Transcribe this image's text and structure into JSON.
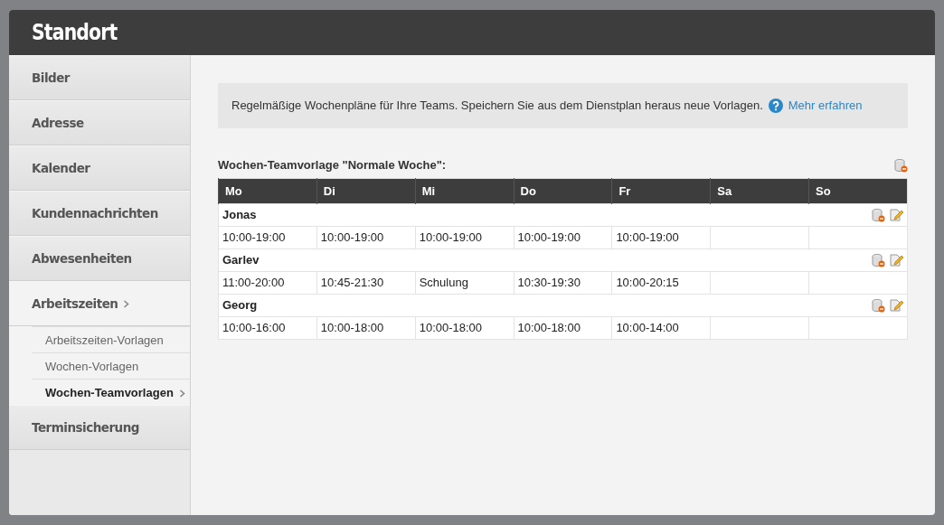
{
  "header": {
    "title": "Standort"
  },
  "sidebar": {
    "items": [
      {
        "label": "Bilder",
        "expanded": false
      },
      {
        "label": "Adresse",
        "expanded": false
      },
      {
        "label": "Kalender",
        "expanded": false
      },
      {
        "label": "Kundennachrichten",
        "expanded": false
      },
      {
        "label": "Abwesenheiten",
        "expanded": false
      },
      {
        "label": "Arbeitszeiten",
        "expanded": true,
        "children": [
          {
            "label": "Arbeitszeiten-Vorlagen",
            "selected": false
          },
          {
            "label": "Wochen-Vorlagen",
            "selected": false
          },
          {
            "label": "Wochen-Teamvorlagen",
            "selected": true
          }
        ]
      },
      {
        "label": "Terminsicherung",
        "expanded": false
      }
    ]
  },
  "info": {
    "text": "Regelmäßige Wochenpläne für Ihre Teams. Speichern Sie aus dem Dienstplan heraus neue Vorlagen.",
    "link": "Mehr erfahren"
  },
  "template": {
    "title": "Wochen-Teamvorlage \"Normale Woche\":",
    "columns": [
      "Mo",
      "Di",
      "Mi",
      "Do",
      "Fr",
      "Sa",
      "So"
    ],
    "teams": [
      {
        "name": "Jonas",
        "shifts": [
          "10:00-19:00",
          "10:00-19:00",
          "10:00-19:00",
          "10:00-19:00",
          "10:00-19:00"
        ]
      },
      {
        "name": "Garlev",
        "shifts": [
          "11:00-20:00",
          "10:45-21:30",
          "Schulung",
          "10:30-19:30",
          "10:00-20:15"
        ]
      },
      {
        "name": "Georg",
        "shifts": [
          "10:00-16:00",
          "10:00-18:00",
          "10:00-18:00",
          "10:00-18:00",
          "10:00-14:00"
        ]
      }
    ]
  }
}
